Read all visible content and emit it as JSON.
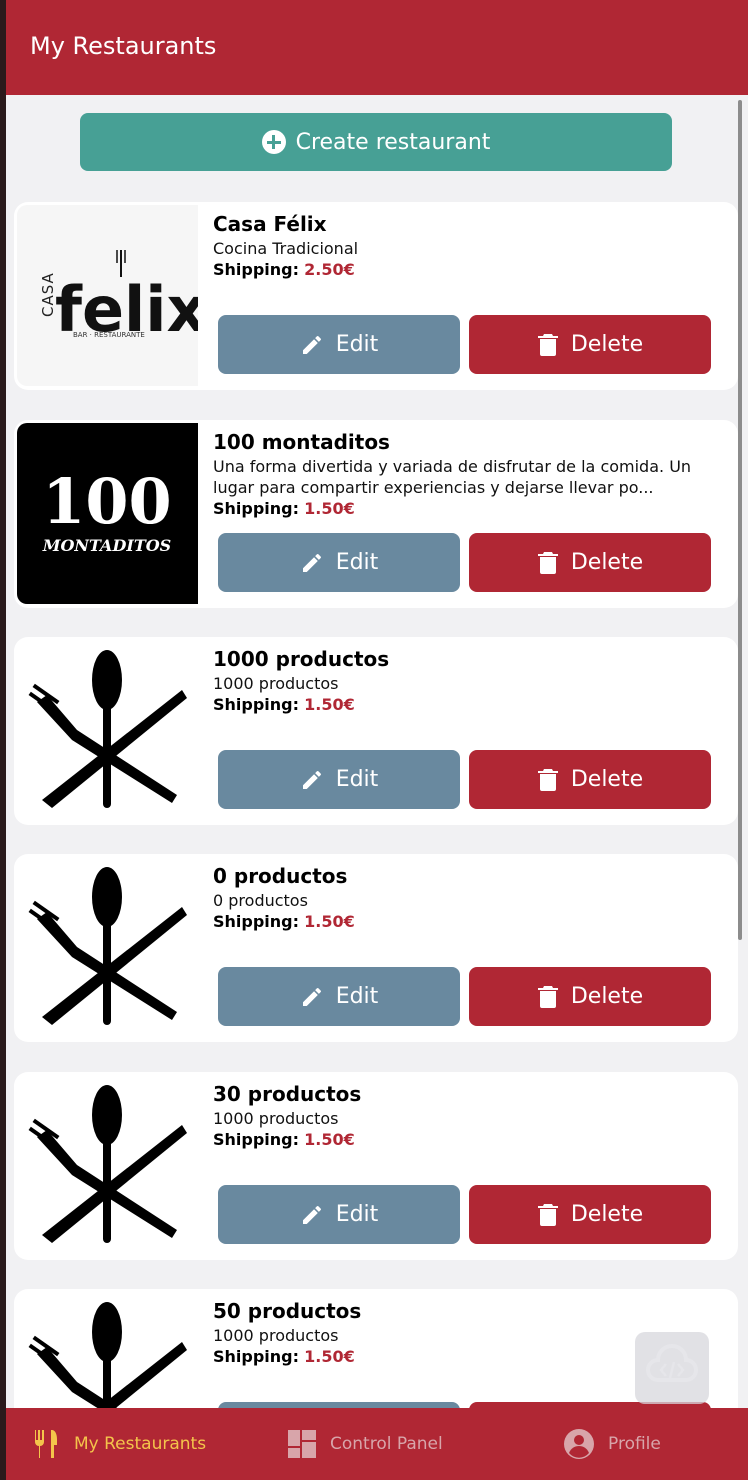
{
  "header": {
    "title": "My Restaurants"
  },
  "create_button": {
    "label": "Create restaurant"
  },
  "restaurants": [
    {
      "name": "Casa Félix",
      "description": "Cocina Tradicional",
      "shipping_label": "Shipping:",
      "shipping_value": "2.50€",
      "logo": "casa-felix-logo",
      "logo_text_casa": "CASA",
      "logo_text_felix": "felix",
      "logo_text_sub": "BAR · RESTAURANTE"
    },
    {
      "name": "100 montaditos",
      "description": "Una forma divertida y variada de disfrutar de la comida. Un lugar para compartir experiencias y dejarse llevar po...",
      "shipping_label": "Shipping:",
      "shipping_value": "1.50€",
      "logo": "100-montaditos-logo",
      "logo_text_num": "100",
      "logo_text_word": "MONTADITOS"
    },
    {
      "name": "1000 productos",
      "description": "1000 productos",
      "shipping_label": "Shipping:",
      "shipping_value": "1.50€",
      "logo": "cutlery-icon"
    },
    {
      "name": "0 productos",
      "description": "0 productos",
      "shipping_label": "Shipping:",
      "shipping_value": "1.50€",
      "logo": "cutlery-icon"
    },
    {
      "name": "30 productos",
      "description": "1000 productos",
      "shipping_label": "Shipping:",
      "shipping_value": "1.50€",
      "logo": "cutlery-icon"
    },
    {
      "name": "50 productos",
      "description": "1000 productos",
      "shipping_label": "Shipping:",
      "shipping_value": "1.50€",
      "logo": "cutlery-icon"
    }
  ],
  "actions": {
    "edit_label": "Edit",
    "delete_label": "Delete"
  },
  "tabs": [
    {
      "label": "My Restaurants",
      "icon": "cutlery-icon",
      "active": true
    },
    {
      "label": "Control Panel",
      "icon": "dashboard-icon",
      "active": false
    },
    {
      "label": "Profile",
      "icon": "account-circle-icon",
      "active": false
    }
  ],
  "colors": {
    "primary": "#b02734",
    "create": "#47a095",
    "edit": "#69899f",
    "active_tab": "#f4c44b"
  }
}
